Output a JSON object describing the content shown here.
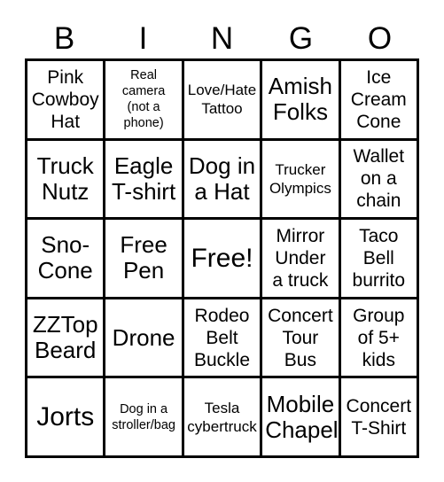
{
  "card": {
    "title_letters": [
      "B",
      "I",
      "N",
      "G",
      "O"
    ],
    "columns": 5,
    "rows": 5,
    "border_color": "#000000",
    "background_color": "#ffffff",
    "text_color": "#000000",
    "free_space": {
      "label": "Free!",
      "row": 3,
      "column": 3
    },
    "cells": [
      {
        "text": "Pink\nCowboy\nHat",
        "size": "md"
      },
      {
        "text": "Real\ncamera\n(not a\nphone)",
        "size": "xs"
      },
      {
        "text": "Love/Hate\nTattoo",
        "size": "sm"
      },
      {
        "text": "Amish\nFolks",
        "size": "lg"
      },
      {
        "text": "Ice\nCream\nCone",
        "size": "md"
      },
      {
        "text": "Truck\nNutz",
        "size": "lg"
      },
      {
        "text": "Eagle\nT-shirt",
        "size": "lg"
      },
      {
        "text": "Dog in\na Hat",
        "size": "lg"
      },
      {
        "text": "Trucker\nOlympics",
        "size": "sm"
      },
      {
        "text": "Wallet\non a\nchain",
        "size": "md"
      },
      {
        "text": "Sno-\nCone",
        "size": "lg"
      },
      {
        "text": "Free\nPen",
        "size": "lg"
      },
      {
        "text": "Free!",
        "size": "xl"
      },
      {
        "text": "Mirror\nUnder\na truck",
        "size": "md"
      },
      {
        "text": "Taco\nBell\nburrito",
        "size": "md"
      },
      {
        "text": "ZZTop\nBeard",
        "size": "lg"
      },
      {
        "text": "Drone",
        "size": "lg"
      },
      {
        "text": "Rodeo\nBelt\nBuckle",
        "size": "md"
      },
      {
        "text": "Concert\nTour\nBus",
        "size": "md"
      },
      {
        "text": "Group\nof 5+\nkids",
        "size": "md"
      },
      {
        "text": "Jorts",
        "size": "xl"
      },
      {
        "text": "Dog in a\nstroller/bag",
        "size": "xs"
      },
      {
        "text": "Tesla\ncybertruck",
        "size": "sm"
      },
      {
        "text": "Mobile\nChapel",
        "size": "lg"
      },
      {
        "text": "Concert\nT-Shirt",
        "size": "md"
      }
    ]
  }
}
